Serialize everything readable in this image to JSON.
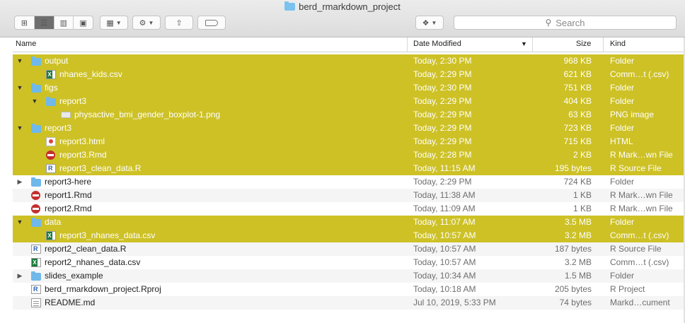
{
  "window": {
    "title": "berd_rmarkdown_project"
  },
  "toolbar": {
    "view_icon": "icon-view-icon",
    "view_list": "list-view-icon",
    "view_columns": "column-view-icon",
    "view_gallery": "gallery-view-icon",
    "group_icon": "grid-group-icon",
    "action_icon": "gear-icon",
    "share_icon": "share-icon",
    "tag_icon": "tag-icon",
    "dropbox_icon": "dropbox-icon"
  },
  "search": {
    "placeholder": "Search"
  },
  "columns": {
    "name": "Name",
    "date": "Date Modified",
    "size": "Size",
    "kind": "Kind"
  },
  "rows": [
    {
      "name": "output",
      "date": "Today, 2:30 PM",
      "size": "968 KB",
      "kind": "Folder",
      "level": 0,
      "icon": "folder",
      "disclosure": "open",
      "highlight": true
    },
    {
      "name": "nhanes_kids.csv",
      "date": "Today, 2:29 PM",
      "size": "621 KB",
      "kind": "Comm…t (.csv)",
      "level": 1,
      "icon": "csv",
      "disclosure": "",
      "highlight": true
    },
    {
      "name": "figs",
      "date": "Today, 2:30 PM",
      "size": "751 KB",
      "kind": "Folder",
      "level": 0,
      "icon": "folder",
      "disclosure": "open",
      "highlight": true
    },
    {
      "name": "report3",
      "date": "Today, 2:29 PM",
      "size": "404 KB",
      "kind": "Folder",
      "level": 1,
      "icon": "folder",
      "disclosure": "open",
      "highlight": true
    },
    {
      "name": "physactive_bmi_gender_boxplot-1.png",
      "date": "Today, 2:29 PM",
      "size": "63 KB",
      "kind": "PNG image",
      "level": 2,
      "icon": "png",
      "disclosure": "",
      "highlight": true
    },
    {
      "name": "report3",
      "date": "Today, 2:29 PM",
      "size": "723 KB",
      "kind": "Folder",
      "level": 0,
      "icon": "folder",
      "disclosure": "open",
      "highlight": true
    },
    {
      "name": "report3.html",
      "date": "Today, 2:29 PM",
      "size": "715 KB",
      "kind": "HTML",
      "level": 1,
      "icon": "html",
      "disclosure": "",
      "highlight": true
    },
    {
      "name": "report3.Rmd",
      "date": "Today, 2:28 PM",
      "size": "2 KB",
      "kind": "R Mark…wn File",
      "level": 1,
      "icon": "rmd",
      "disclosure": "",
      "highlight": true
    },
    {
      "name": "report3_clean_data.R",
      "date": "Today, 11:15 AM",
      "size": "195 bytes",
      "kind": "R Source File",
      "level": 1,
      "icon": "rfile",
      "disclosure": "",
      "highlight": true
    },
    {
      "name": "report3-here",
      "date": "Today, 2:29 PM",
      "size": "724 KB",
      "kind": "Folder",
      "level": 0,
      "icon": "folder",
      "disclosure": "closed",
      "highlight": false
    },
    {
      "name": "report1.Rmd",
      "date": "Today, 11:38 AM",
      "size": "1 KB",
      "kind": "R Mark…wn File",
      "level": 0,
      "icon": "rmd",
      "disclosure": "",
      "highlight": false
    },
    {
      "name": "report2.Rmd",
      "date": "Today, 11:09 AM",
      "size": "1 KB",
      "kind": "R Mark…wn File",
      "level": 0,
      "icon": "rmd",
      "disclosure": "",
      "highlight": false
    },
    {
      "name": "data",
      "date": "Today, 11:07 AM",
      "size": "3.5 MB",
      "kind": "Folder",
      "level": 0,
      "icon": "folder",
      "disclosure": "open",
      "highlight": true
    },
    {
      "name": "report3_nhanes_data.csv",
      "date": "Today, 10:57 AM",
      "size": "3.2 MB",
      "kind": "Comm…t (.csv)",
      "level": 1,
      "icon": "csv",
      "disclosure": "",
      "highlight": true
    },
    {
      "name": "report2_clean_data.R",
      "date": "Today, 10:57 AM",
      "size": "187 bytes",
      "kind": "R Source File",
      "level": 0,
      "icon": "rfile",
      "disclosure": "",
      "highlight": false
    },
    {
      "name": "report2_nhanes_data.csv",
      "date": "Today, 10:57 AM",
      "size": "3.2 MB",
      "kind": "Comm…t (.csv)",
      "level": 0,
      "icon": "csv",
      "disclosure": "",
      "highlight": false
    },
    {
      "name": "slides_example",
      "date": "Today, 10:34 AM",
      "size": "1.5 MB",
      "kind": "Folder",
      "level": 0,
      "icon": "folder",
      "disclosure": "closed",
      "highlight": false
    },
    {
      "name": "berd_rmarkdown_project.Rproj",
      "date": "Today, 10:18 AM",
      "size": "205 bytes",
      "kind": "R Project",
      "level": 0,
      "icon": "rproj",
      "disclosure": "",
      "highlight": false
    },
    {
      "name": "README.md",
      "date": "Jul 10, 2019, 5:33 PM",
      "size": "74 bytes",
      "kind": "Markd…cument",
      "level": 0,
      "icon": "md",
      "disclosure": "",
      "highlight": false
    }
  ]
}
